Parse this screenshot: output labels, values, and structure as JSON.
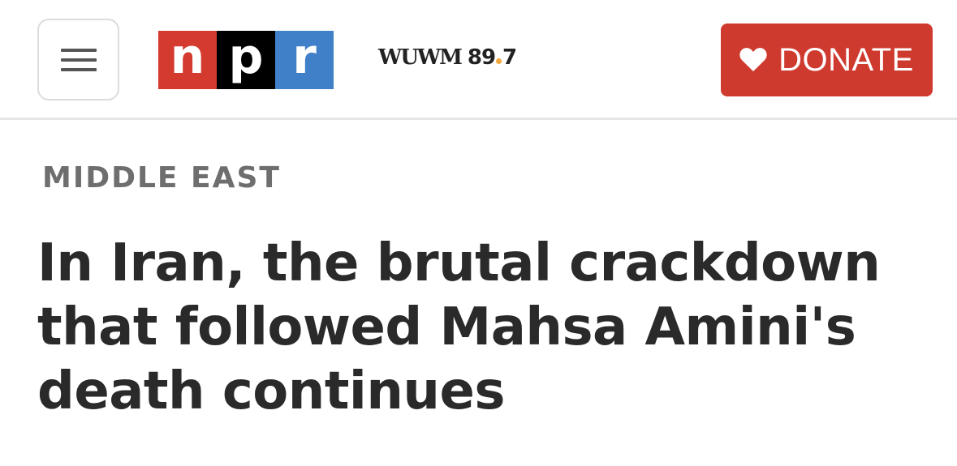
{
  "header": {
    "menu_icon": "hamburger-menu-icon",
    "logo": {
      "letters": [
        "n",
        "p",
        "r"
      ],
      "colors": {
        "n": "#d43a2e",
        "p": "#000000",
        "r": "#3f80c8"
      }
    },
    "station": {
      "call_letters": "WUWM",
      "frequency_main": "89",
      "frequency_decimal": "7",
      "dot_color": "#f2a93b"
    },
    "donate": {
      "label": "DONATE",
      "icon": "heart-icon",
      "color": "#cf3a2f"
    }
  },
  "article": {
    "section": "MIDDLE EAST",
    "headline": "In Iran, the brutal crackdown that followed Mahsa Amini's death continues"
  }
}
